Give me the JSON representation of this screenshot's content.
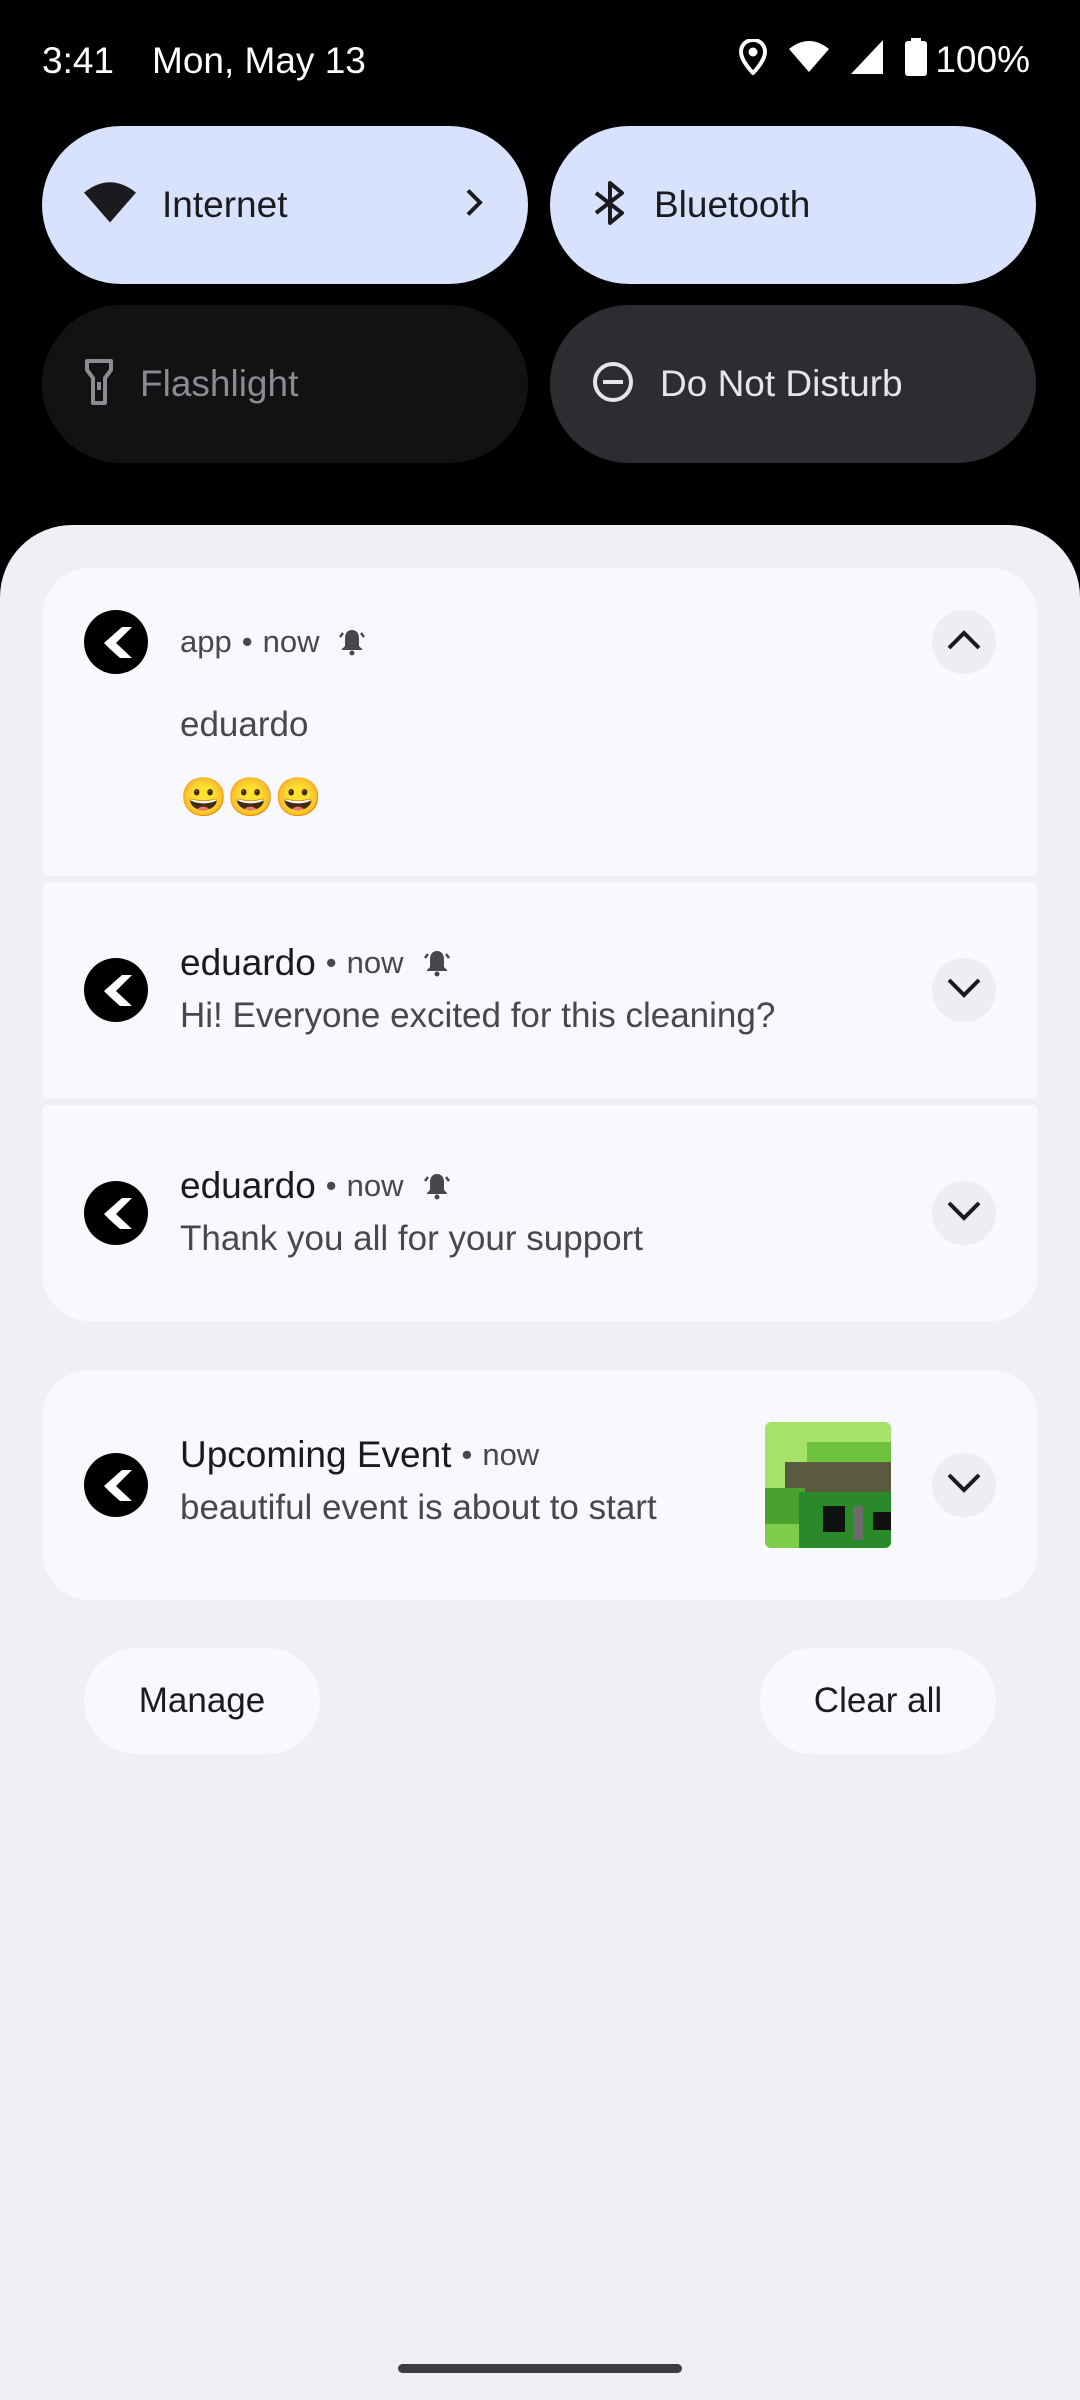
{
  "status_bar": {
    "time": "3:41",
    "date": "Mon, May 13",
    "battery": "100%",
    "icons": [
      "location-icon",
      "wifi-icon",
      "signal-icon",
      "battery-icon"
    ]
  },
  "tiles": [
    {
      "label": "Internet",
      "icon": "wifi-icon",
      "state": "on",
      "has_chevron": true
    },
    {
      "label": "Bluetooth",
      "icon": "bluetooth-icon",
      "state": "on"
    },
    {
      "label": "Flashlight",
      "icon": "flashlight-icon",
      "state": "off"
    },
    {
      "label": "Do Not Disturb",
      "icon": "do-not-disturb-icon",
      "state": "off"
    }
  ],
  "notifications": {
    "group_header": {
      "app": "app",
      "time": "now",
      "title": "eduardo",
      "body": "😀😀😀"
    },
    "items": [
      {
        "title": "eduardo",
        "time": "now",
        "body": "Hi! Everyone excited for this cleaning?"
      },
      {
        "title": "eduardo",
        "time": "now",
        "body": "Thank you all for your support"
      }
    ],
    "event": {
      "title": "Upcoming Event",
      "time": "now",
      "body": "beautiful event is about to start"
    },
    "separator": "•"
  },
  "footer": {
    "manage_label": "Manage",
    "clear_label": "Clear all"
  },
  "colors": {
    "tile_on": "#d8e2fc",
    "tile_off": "#121214",
    "shade_bg": "#eff0f6",
    "card_bg": "#f8f8fd"
  }
}
